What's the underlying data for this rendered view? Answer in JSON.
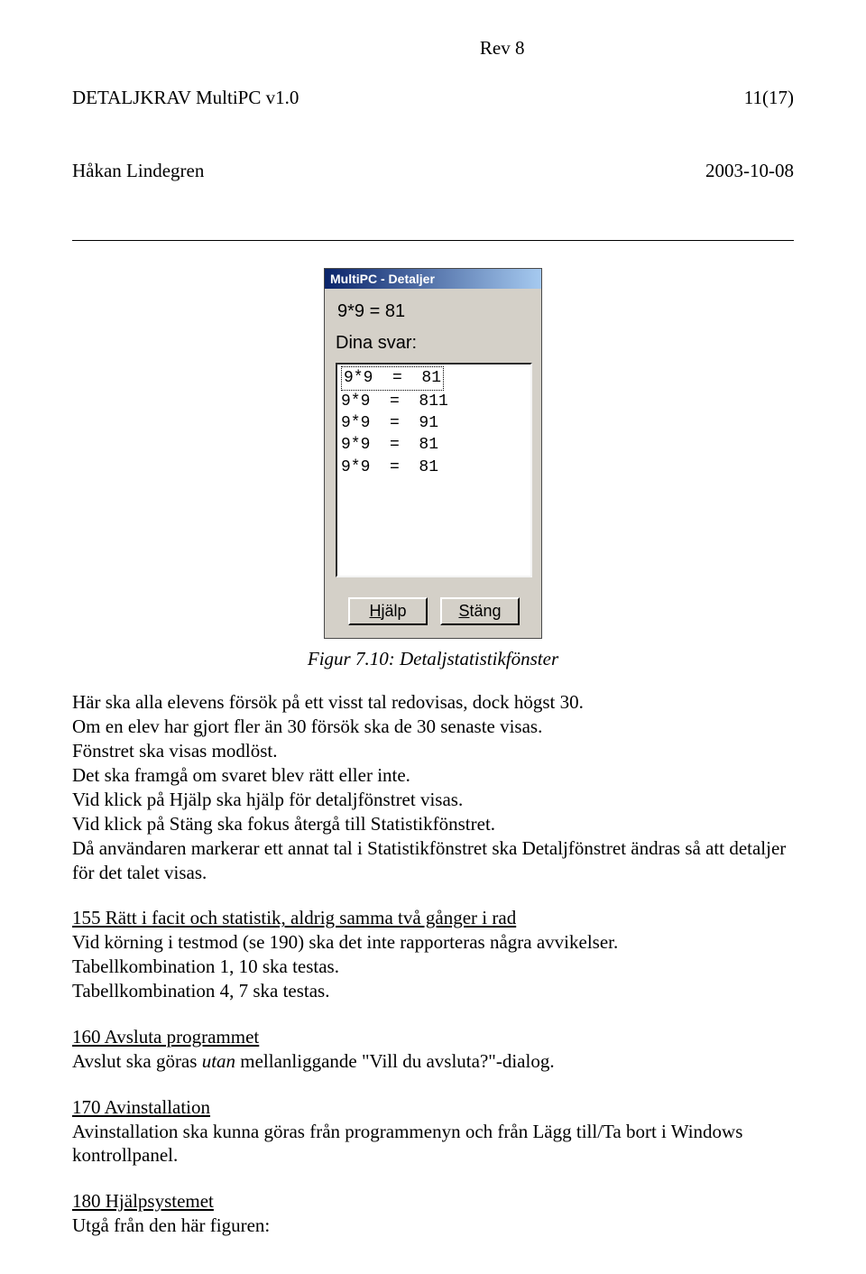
{
  "header": {
    "doc_title": "DETALJKRAV MultiPC v1.0",
    "author": "Håkan Lindegren",
    "revision": "Rev 8",
    "page": "11(17)",
    "date": "2003-10-08"
  },
  "dialog": {
    "title": "MultiPC - Detaljer",
    "equation": "9*9 = 81",
    "label": "Dina svar:",
    "rows": [
      "9*9  =  81",
      "9*9  =  811",
      "9*9  =  91",
      "9*9  =  81",
      "9*9  =  81"
    ],
    "btn_help_u": "H",
    "btn_help_rest": "jälp",
    "btn_close_u": "S",
    "btn_close_rest": "täng"
  },
  "caption": "Figur 7.10: Detaljstatistikfönster",
  "para1": {
    "l1": "Här ska alla elevens försök på ett visst tal redovisas, dock högst 30.",
    "l2": "Om en elev har gjort fler än 30 försök ska de 30 senaste visas.",
    "l3": "Fönstret ska visas modlöst.",
    "l4": "Det ska framgå om svaret blev rätt eller inte.",
    "l5": "Vid klick på Hjälp ska hjälp för detaljfönstret visas.",
    "l6": "Vid klick på Stäng ska fokus återgå till Statistikfönstret.",
    "l7": "Då användaren markerar ett annat tal i Statistikfönstret ska Detaljfönstret ändras så att detaljer för det talet visas."
  },
  "sec155": {
    "title": "155 Rätt i facit och statistik, aldrig samma två gånger i rad",
    "l1": "Vid körning i testmod (se 190) ska det inte rapporteras några avvikelser.",
    "l2": "Tabellkombination 1, 10 ska testas.",
    "l3": "Tabellkombination 4, 7 ska testas."
  },
  "sec160": {
    "title": "160 Avsluta programmet",
    "l1a": "Avslut ska göras ",
    "l1i": "utan",
    "l1b": " mellanliggande \"Vill du avsluta?\"-dialog."
  },
  "sec170": {
    "title": "170 Avinstallation",
    "l1": "Avinstallation ska kunna göras från programmenyn och från Lägg till/Ta bort i Windows kontrollpanel."
  },
  "sec180": {
    "title": "180 Hjälpsystemet",
    "l1": "Utgå från den här figuren:"
  }
}
